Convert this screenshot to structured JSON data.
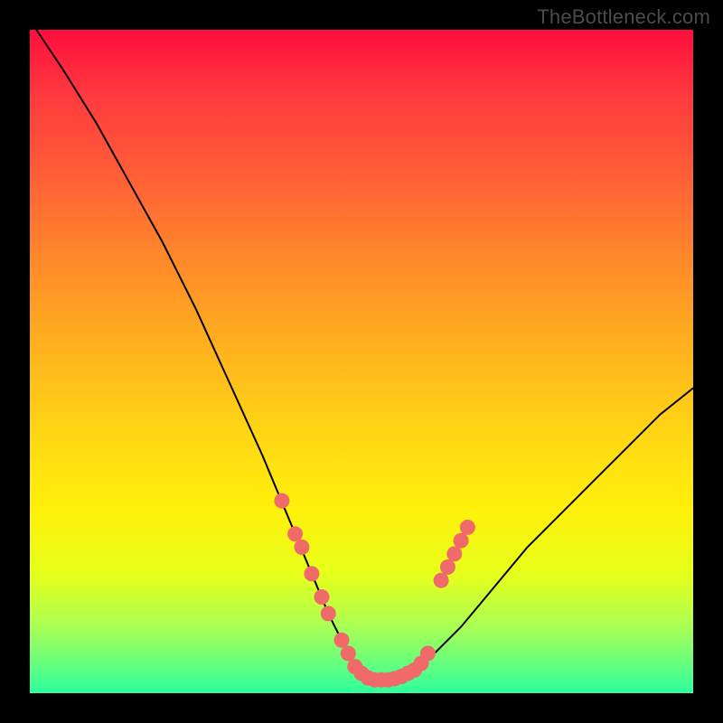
{
  "watermark": "TheBottleneck.com",
  "chart_data": {
    "type": "line",
    "title": "",
    "xlabel": "",
    "ylabel": "",
    "xlim": [
      0,
      100
    ],
    "ylim": [
      0,
      100
    ],
    "grid": false,
    "legend": false,
    "series": [
      {
        "name": "curve",
        "color": "#000000",
        "x": [
          1,
          5,
          10,
          15,
          20,
          25,
          30,
          35,
          40,
          45,
          48,
          50,
          52,
          54,
          56,
          58,
          60,
          65,
          70,
          75,
          80,
          85,
          90,
          95,
          100
        ],
        "values": [
          100,
          94,
          86,
          77,
          68,
          58,
          47,
          36,
          24,
          12,
          6,
          3,
          2,
          2,
          2,
          3,
          5,
          10,
          16,
          22,
          27,
          32,
          37,
          42,
          46
        ]
      }
    ],
    "annotations": [
      {
        "name": "dot-cluster",
        "color": "#f16a6a",
        "points": [
          {
            "x": 38,
            "y": 29
          },
          {
            "x": 40,
            "y": 24
          },
          {
            "x": 41,
            "y": 22
          },
          {
            "x": 42.5,
            "y": 18
          },
          {
            "x": 44,
            "y": 14.5
          },
          {
            "x": 45,
            "y": 12
          },
          {
            "x": 47,
            "y": 8
          },
          {
            "x": 48,
            "y": 6
          },
          {
            "x": 49,
            "y": 4
          },
          {
            "x": 50,
            "y": 3
          },
          {
            "x": 51,
            "y": 2.3
          },
          {
            "x": 52,
            "y": 2
          },
          {
            "x": 53,
            "y": 2
          },
          {
            "x": 54,
            "y": 2
          },
          {
            "x": 55,
            "y": 2.2
          },
          {
            "x": 56,
            "y": 2.5
          },
          {
            "x": 57,
            "y": 3
          },
          {
            "x": 58,
            "y": 3.5
          },
          {
            "x": 59,
            "y": 4.5
          },
          {
            "x": 60,
            "y": 6
          },
          {
            "x": 62,
            "y": 17
          },
          {
            "x": 63,
            "y": 19
          },
          {
            "x": 64,
            "y": 21
          },
          {
            "x": 65,
            "y": 23
          },
          {
            "x": 66,
            "y": 25
          }
        ]
      }
    ]
  }
}
